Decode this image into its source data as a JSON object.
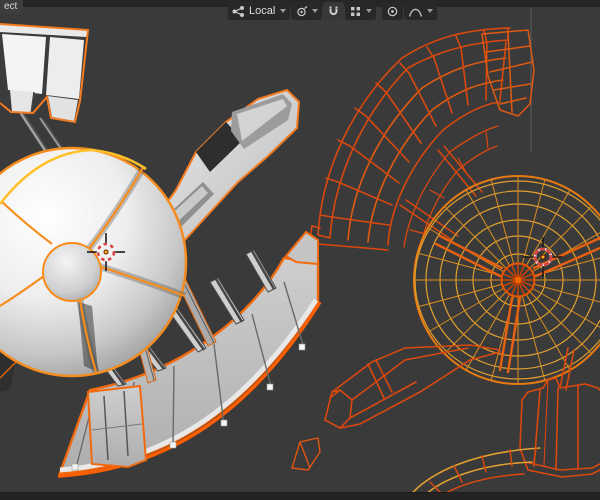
{
  "header": {
    "menu_fragment": "ect",
    "orientation_label": "Local",
    "icons": {
      "orientation": "axes-orientation-icon",
      "pivot": "pivot-point-icon",
      "snap": "magnet-icon",
      "snap_mode": "increment-grid-icon",
      "proportional": "circle-dot-icon",
      "falloff": "smooth-falloff-curve-icon",
      "dropdown": "chevron-down"
    }
  },
  "colors": {
    "viewport_background": "#3a3a3a",
    "header_strip": "#262626",
    "widget_background": "#282828",
    "selection_outline_orange": "#f47b20",
    "active_outline_yellow": "#ffc02a",
    "wireframe_orange": "#d9480f",
    "wireframe_yellow": "#e2a030",
    "wire_hub_red": "#d04400",
    "cursor_red": "#d94343",
    "solid_surface_light": "#f2f2f2",
    "solid_surface_mid": "#bdbdbd"
  }
}
